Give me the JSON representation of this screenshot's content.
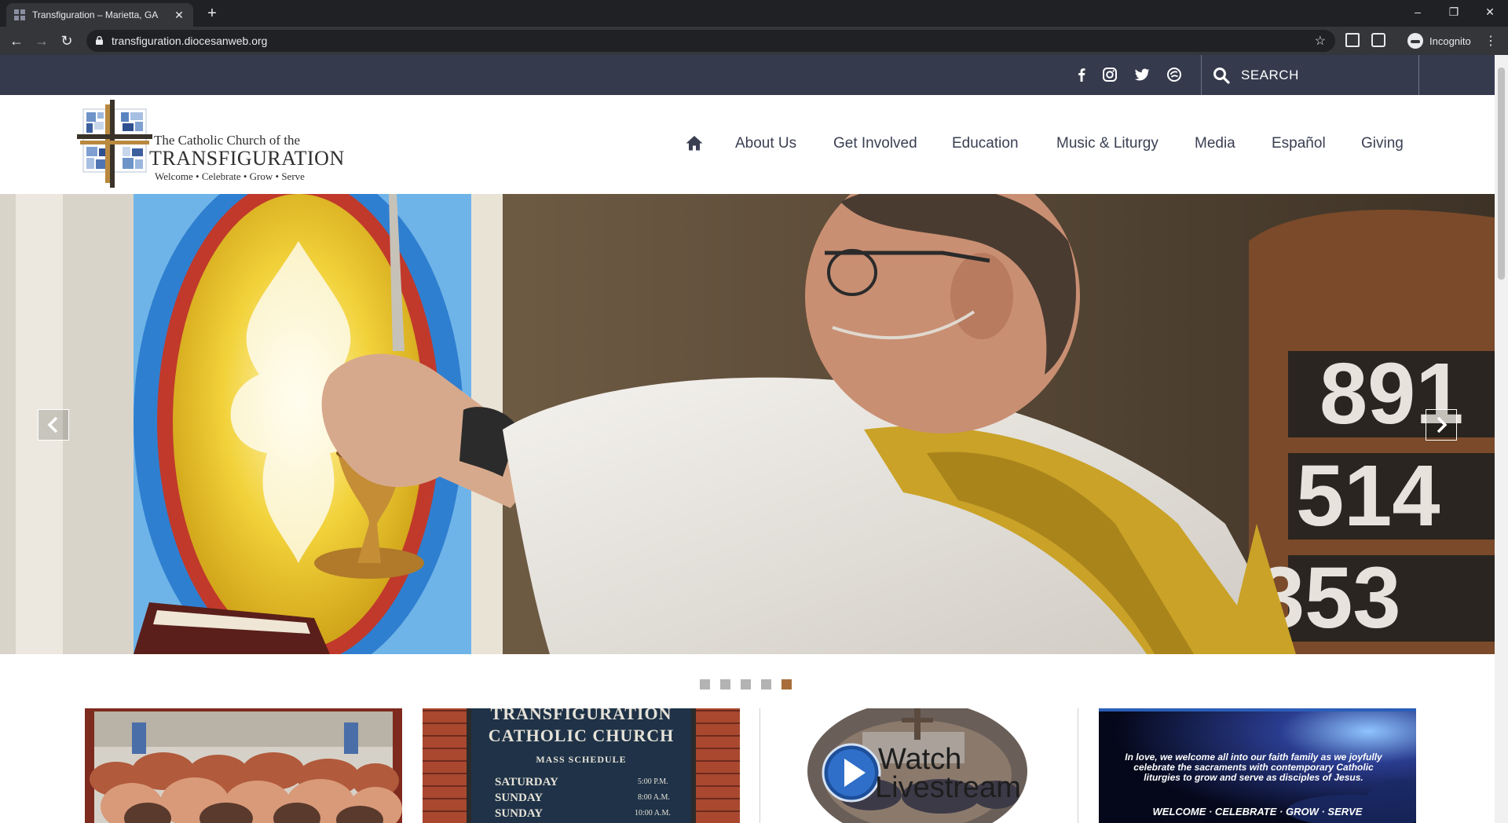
{
  "browser": {
    "tab_title": "Transfiguration – Marietta, GA",
    "tab_close": "✕",
    "new_tab": "+",
    "url": "transfiguration.diocesanweb.org",
    "profile_label": "Incognito",
    "window_controls": {
      "minimize": "–",
      "restore": "❐",
      "close": "✕"
    },
    "back": "←",
    "forward": "→",
    "reload": "↻",
    "star": "☆",
    "menu": "⋮"
  },
  "utility_bar": {
    "social": [
      {
        "name": "facebook-icon",
        "glyph": "f"
      },
      {
        "name": "instagram-icon",
        "glyph": "◎"
      },
      {
        "name": "twitter-icon",
        "glyph": "🐦"
      },
      {
        "name": "flocknote-icon",
        "glyph": "✇"
      }
    ],
    "search_label": "SEARCH"
  },
  "logo": {
    "line1": "The Catholic Church of the",
    "line2": "TRANSFIGURATION",
    "line3": "Welcome • Celebrate • Grow • Serve"
  },
  "nav": {
    "items": [
      "About Us",
      "Get Involved",
      "Education",
      "Music & Liturgy",
      "Media",
      "Español",
      "Giving"
    ]
  },
  "slider": {
    "dots_total": 5,
    "active_dot": 5
  },
  "cards": {
    "sign_line1": "TRANSFIGURATION",
    "sign_line2": "CATHOLIC CHURCH",
    "sign_line3": "MASS SCHEDULE",
    "sign_rows": [
      {
        "day": "SATURDAY",
        "time": "5:00 P.M."
      },
      {
        "day": "SUNDAY",
        "time": "8:00 A.M."
      },
      {
        "day": "SUNDAY",
        "time": "10:00 A.M."
      }
    ],
    "watch_line1": "Watch",
    "watch_line2": "Livestream",
    "mission_text": "In love, we welcome all into our faith family as we joyfully celebrate the sacraments with contemporary Catholic liturgies to grow and serve as disciples of Jesus.",
    "mission_footer": "WELCOME · CELEBRATE · GROW · SERVE"
  },
  "hero_numbers": [
    "891",
    "514",
    "353"
  ],
  "colors": {
    "utility_bar": "#353a4d",
    "nav_text": "#3a3f52",
    "active_dot": "#a86d3a"
  }
}
